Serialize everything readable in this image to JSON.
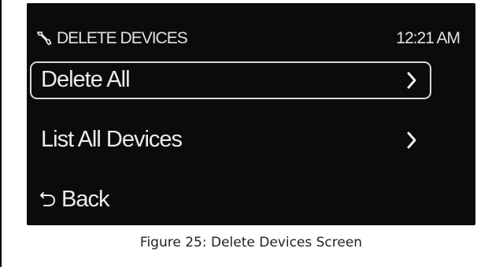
{
  "screen": {
    "title": "DELETE DEVICES",
    "clock": "12:21 AM",
    "menu_items": [
      {
        "label": "Delete All",
        "selected": true,
        "icon": "chevron-right-icon"
      },
      {
        "label": "List All Devices",
        "selected": false,
        "icon": "chevron-right-icon"
      }
    ],
    "back_label": "Back",
    "icons": {
      "title": "wrench-icon",
      "back": "back-arrow-icon"
    },
    "colors": {
      "screen_background": "#0b0b0b",
      "text": "#ececec",
      "selection_border": "#d8d8d8"
    }
  },
  "caption": "Figure 25: Delete Devices Screen"
}
